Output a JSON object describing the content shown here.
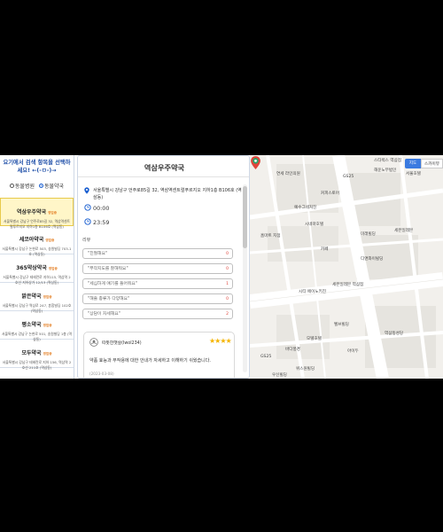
{
  "left_panel": {
    "prompt": "요기에서 검색 항목을 선택하세요! ←(-ㅁ-)→",
    "radio_animal": "동물병원",
    "radio_pharmacy": "동물약국",
    "items": [
      {
        "name": "역삼우주약국",
        "badge": "영업중",
        "addr": "서울특별시 강남구 언주로85길 32, 역삼역센트럴푸르지오 지하1층 B106호 (역삼동)",
        "selected": true
      },
      {
        "name": "세코아약국",
        "badge": "영업중",
        "addr": "서울특별시 강남구 논현로 503, 송원빌딩 703-1호 (역삼동)",
        "selected": false
      },
      {
        "name": "365약상약국",
        "badge": "영업중",
        "addr": "서울특별시 강남구 테헤란로 지하115, 역삼역 2호선 지하상가 12/13 (역삼동)",
        "selected": false
      },
      {
        "name": "밝은약국",
        "badge": "영업중",
        "addr": "서울특별시 강남구 역삼로 247, 혼합빌딩 102호 (역삼동)",
        "selected": false
      },
      {
        "name": "평소약국",
        "badge": "영업중",
        "addr": "서울특별시 강남구 논현로 501, 송원빌딩 1층 (역삼동)",
        "selected": false
      },
      {
        "name": "모두약국",
        "badge": "영업중",
        "addr": "서울특별시 강남구 테헤란로 지하 156, 역삼역 2호선 211호 (역삼동)",
        "selected": false
      }
    ]
  },
  "detail": {
    "title": "역삼우주약국",
    "address": "서울특별시 강남구 언주로85길 32, 역삼역센트럴푸르지오 지하1층 B106호 (역삼동)",
    "open_time": "00:00",
    "close_time": "23:59",
    "reviews_label": "리뷰",
    "review_buttons": [
      {
        "text": "\"친절해요\"",
        "count": "0"
      },
      {
        "text": "\"부작지도를 잘해줘요\"",
        "count": "0"
      },
      {
        "text": "\"세심하게 얘기를 들어줘요\"",
        "count": "1"
      },
      {
        "text": "\"해줄 종류가 다양해요\"",
        "count": "0"
      },
      {
        "text": "\"상담이 자세해요\"",
        "count": "2"
      }
    ],
    "review": {
      "name": "따뜻한햇살(Iwol234)",
      "stars": "★★★★",
      "text": "약품 효능과 부작용에 대한 안내가 자세하고 이해하기 쉬웠습니다.",
      "date": "(2023-03-08)"
    }
  },
  "map": {
    "toggle_map": "지도",
    "toggle_sky": "스카이뷰",
    "labels": [
      {
        "t": "스타벅스 역삼점"
      },
      {
        "t": "해운노무법인"
      },
      {
        "t": "서울호텔"
      },
      {
        "t": "연세 라인의원"
      },
      {
        "t": "커피스토어"
      },
      {
        "t": "GS25"
      },
      {
        "t": "예수그네처친"
      },
      {
        "t": "시네마호텔"
      },
      {
        "t": "홈마트 지점"
      },
      {
        "t": "세븐일레븐"
      },
      {
        "t": "미래빌딩"
      },
      {
        "t": "카페"
      },
      {
        "t": "디앤와이빌딩"
      },
      {
        "t": "세븐일레븐 역삼점"
      },
      {
        "t": "시티 에이노키친"
      },
      {
        "t": "벨브빌딩"
      },
      {
        "t": "GS25"
      },
      {
        "t": "모텔호텔"
      },
      {
        "t": "바다풍경"
      },
      {
        "t": "위스원빌딩"
      },
      {
        "t": "역삼동성당"
      },
      {
        "t": "우신빌딩"
      },
      {
        "t": "아이두"
      }
    ]
  }
}
